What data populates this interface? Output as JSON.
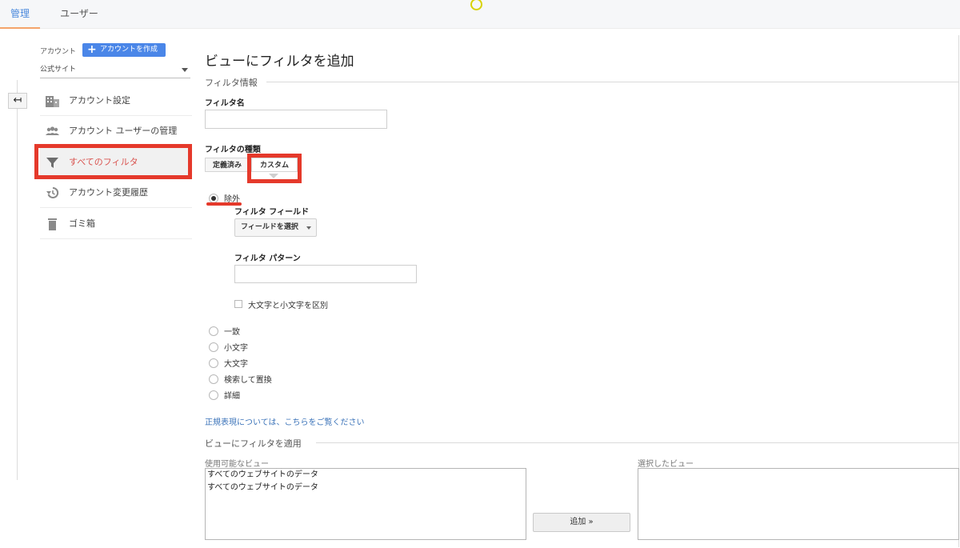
{
  "top_tabs": [
    {
      "label": "管理",
      "active": true
    },
    {
      "label": "ユーザー",
      "active": false
    }
  ],
  "sidebar": {
    "account_label": "アカウント",
    "create_account_label": "アカウントを作成",
    "account_select_value": "公式サイト",
    "items": [
      {
        "label": "アカウント設定",
        "icon": "building-icon"
      },
      {
        "label": "アカウント ユーザーの管理",
        "icon": "users-icon"
      },
      {
        "label": "すべてのフィルタ",
        "icon": "filter-icon",
        "selected": true
      },
      {
        "label": "アカウント変更履歴",
        "icon": "history-icon"
      },
      {
        "label": "ゴミ箱",
        "icon": "trash-icon"
      }
    ]
  },
  "main": {
    "title": "ビューにフィルタを追加",
    "filter_info_section": "フィルタ情報",
    "filter_name_label": "フィルタ名",
    "filter_name_value": "",
    "filter_type_label": "フィルタの種類",
    "filter_type_tabs": [
      {
        "label": "定義済み",
        "active": false
      },
      {
        "label": "カスタム",
        "active": true
      }
    ],
    "custom_options": {
      "exclude_label": "除外",
      "filter_field_label": "フィルタ フィールド",
      "filter_field_select": "フィールドを選択",
      "filter_pattern_label": "フィルタ パターン",
      "filter_pattern_value": "",
      "case_sensitive_label": "大文字と小文字を区別",
      "other_options": [
        "一致",
        "小文字",
        "大文字",
        "検索して置換",
        "詳細"
      ]
    },
    "regex_link": "正規表現については、こちらをご覧ください",
    "apply_section": "ビューにフィルタを適用",
    "available_views_label": "使用可能なビュー",
    "available_views": [
      "すべてのウェブサイトのデータ",
      "すべてのウェブサイトのデータ"
    ],
    "selected_views_label": "選択したビュー",
    "add_button": "追加 »"
  },
  "colors": {
    "accent": "#4a89dc",
    "highlight": "#e5392b",
    "tab_underline": "#f4a46b",
    "create_button": "#4a86e8",
    "selected_nav_text": "#d9534f",
    "link": "#3b73b9"
  }
}
